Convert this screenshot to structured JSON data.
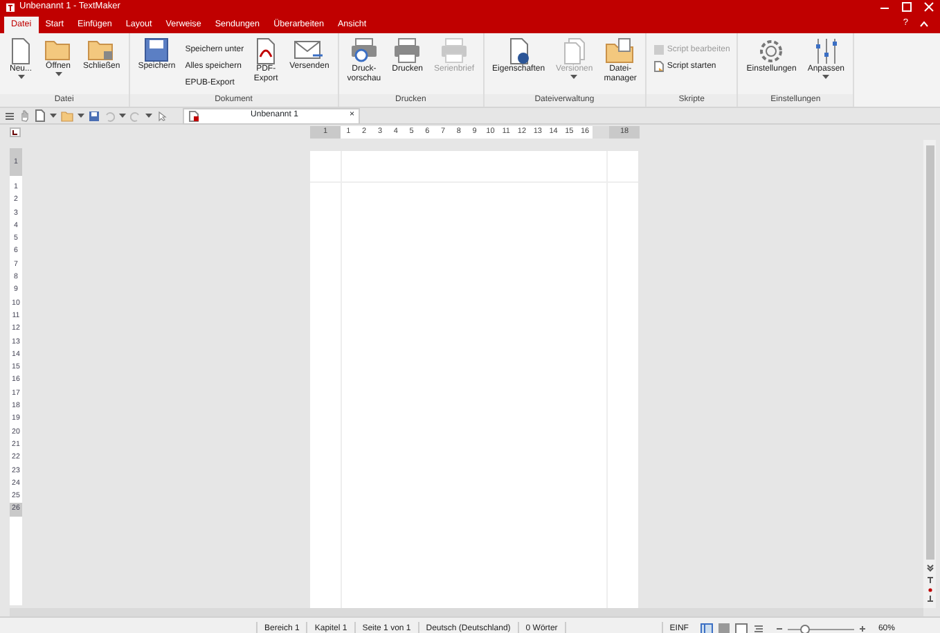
{
  "window": {
    "title": "Unbenannt 1 - TextMaker",
    "help": "?"
  },
  "tabs": [
    {
      "label": "Datei",
      "selected": true
    },
    {
      "label": "Start",
      "selected": false
    },
    {
      "label": "Einfügen",
      "selected": false
    },
    {
      "label": "Layout",
      "selected": false
    },
    {
      "label": "Verweise",
      "selected": false
    },
    {
      "label": "Sendungen",
      "selected": false
    },
    {
      "label": "Überarbeiten",
      "selected": false
    },
    {
      "label": "Ansicht",
      "selected": false
    }
  ],
  "ribbon": [
    {
      "label": "Datei",
      "items": [
        {
          "kind": "large",
          "label": "Neu...",
          "dropdown": true,
          "disabled": false
        },
        {
          "kind": "large",
          "label": "Öffnen",
          "dropdown": true,
          "disabled": false
        },
        {
          "kind": "large",
          "label": "Schließen",
          "dropdown": false,
          "disabled": false
        }
      ]
    },
    {
      "label": "Dokument",
      "items": [
        {
          "kind": "large",
          "label": "Speichern",
          "dropdown": false,
          "disabled": false
        },
        {
          "kind": "stack",
          "items": [
            {
              "label": "Speichern unter",
              "disabled": false
            },
            {
              "label": "Alles speichern",
              "disabled": false
            },
            {
              "label": "EPUB-Export",
              "disabled": false
            }
          ]
        },
        {
          "kind": "large",
          "label": "PDF-\nExport",
          "dropdown": false,
          "disabled": false
        },
        {
          "kind": "large",
          "label": "Versenden",
          "dropdown": false,
          "disabled": false
        }
      ]
    },
    {
      "label": "Drucken",
      "items": [
        {
          "kind": "large",
          "label": "Druck-\nvorschau",
          "dropdown": false,
          "disabled": false
        },
        {
          "kind": "large",
          "label": "Drucken",
          "dropdown": false,
          "disabled": false
        },
        {
          "kind": "large",
          "label": "Serienbrief",
          "dropdown": false,
          "disabled": true
        }
      ]
    },
    {
      "label": "Dateiverwaltung",
      "items": [
        {
          "kind": "large",
          "label": "Eigenschaften",
          "dropdown": false,
          "disabled": false
        },
        {
          "kind": "large",
          "label": "Versionen",
          "dropdown": true,
          "disabled": true
        },
        {
          "kind": "large",
          "label": "Datei-\nmanager",
          "dropdown": false,
          "disabled": false
        }
      ]
    },
    {
      "label": "Skripte",
      "items": [
        {
          "kind": "stack",
          "items": [
            {
              "label": "Script bearbeiten",
              "disabled": true
            },
            {
              "label": "Script starten",
              "disabled": false
            }
          ]
        }
      ]
    },
    {
      "label": "Einstellungen",
      "items": [
        {
          "kind": "large",
          "label": "Einstellungen",
          "dropdown": false,
          "disabled": false
        },
        {
          "kind": "large",
          "label": "Anpassen",
          "dropdown": true,
          "disabled": false
        }
      ]
    }
  ],
  "document_tab": {
    "label": "Unbenannt 1",
    "close": "×"
  },
  "horizontal_ruler": [
    "1",
    "1",
    "2",
    "3",
    "4",
    "5",
    "6",
    "7",
    "8",
    "9",
    "10",
    "11",
    "12",
    "13",
    "14",
    "15",
    "16",
    "18"
  ],
  "vertical_ruler": [
    "1",
    "1",
    "2",
    "3",
    "4",
    "5",
    "6",
    "7",
    "8",
    "9",
    "10",
    "11",
    "12",
    "13",
    "14",
    "15",
    "16",
    "17",
    "18",
    "19",
    "20",
    "21",
    "22",
    "23",
    "24",
    "25",
    "26"
  ],
  "status_bar": {
    "fields": [
      "Bereich 1",
      "Kapitel 1",
      "Seite 1 von 1",
      "Deutsch (Deutschland)",
      "0 Wörter"
    ],
    "mode": "EINF",
    "zoom": "60%",
    "zoom_slider": {
      "level": 0.25
    }
  }
}
